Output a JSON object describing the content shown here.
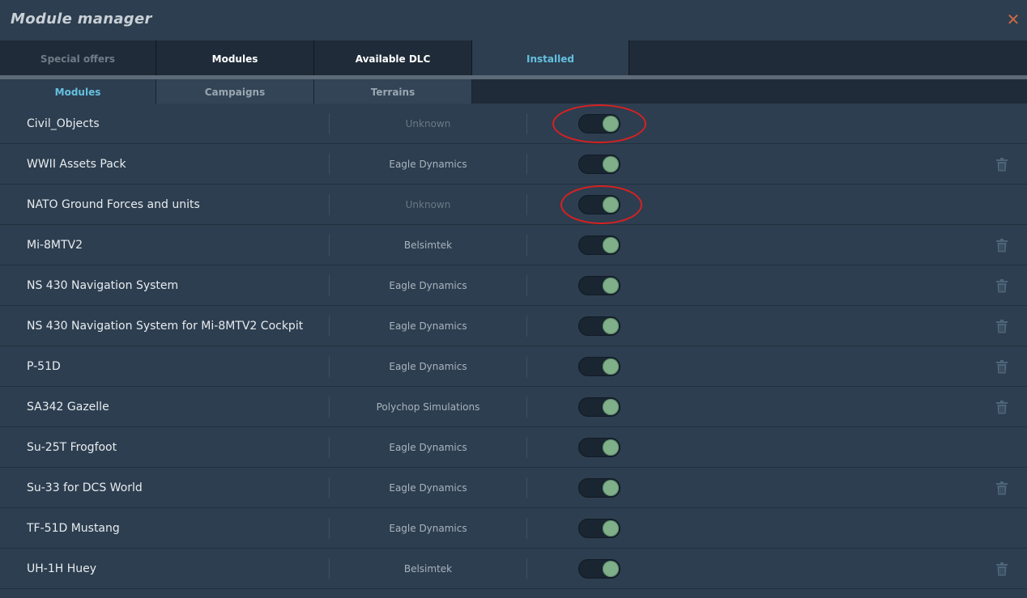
{
  "window": {
    "title": "Module manager",
    "close_icon": "close-icon",
    "close_glyph": "✕"
  },
  "main_tabs": [
    {
      "label": "Special offers",
      "state": "dim"
    },
    {
      "label": "Modules",
      "state": "normal"
    },
    {
      "label": "Available DLC",
      "state": "normal"
    },
    {
      "label": "Installed",
      "state": "active"
    }
  ],
  "sub_tabs": [
    {
      "label": "Modules",
      "state": "active"
    },
    {
      "label": "Campaigns",
      "state": "normal"
    },
    {
      "label": "Terrains",
      "state": "normal"
    }
  ],
  "modules": [
    {
      "name": "Civil_Objects",
      "developer": "Unknown",
      "enabled": true,
      "deletable": false,
      "highlighted": true
    },
    {
      "name": "WWII Assets Pack",
      "developer": "Eagle Dynamics",
      "enabled": true,
      "deletable": true,
      "highlighted": false
    },
    {
      "name": "NATO Ground Forces and units",
      "developer": "Unknown",
      "enabled": true,
      "deletable": false,
      "highlighted": true
    },
    {
      "name": "Mi-8MTV2",
      "developer": "Belsimtek",
      "enabled": true,
      "deletable": true,
      "highlighted": false
    },
    {
      "name": "NS 430 Navigation System",
      "developer": "Eagle Dynamics",
      "enabled": true,
      "deletable": true,
      "highlighted": false
    },
    {
      "name": "NS 430 Navigation System for Mi-8MTV2 Cockpit",
      "developer": "Eagle Dynamics",
      "enabled": true,
      "deletable": true,
      "highlighted": false
    },
    {
      "name": "P-51D",
      "developer": "Eagle Dynamics",
      "enabled": true,
      "deletable": true,
      "highlighted": false
    },
    {
      "name": "SA342 Gazelle",
      "developer": "Polychop Simulations",
      "enabled": true,
      "deletable": true,
      "highlighted": false
    },
    {
      "name": "Su-25T Frogfoot",
      "developer": "Eagle Dynamics",
      "enabled": true,
      "deletable": false,
      "highlighted": false
    },
    {
      "name": "Su-33 for DCS World",
      "developer": "Eagle Dynamics",
      "enabled": true,
      "deletable": true,
      "highlighted": false
    },
    {
      "name": "TF-51D Mustang",
      "developer": "Eagle Dynamics",
      "enabled": true,
      "deletable": false,
      "highlighted": false
    },
    {
      "name": "UH-1H Huey",
      "developer": "Belsimtek",
      "enabled": true,
      "deletable": true,
      "highlighted": false
    }
  ],
  "colors": {
    "background": "#2d3e50",
    "tab_bar": "#1f2b38",
    "accent": "#66c0e0",
    "toggle_on": "#7fb08a",
    "annotation": "#d92020",
    "close": "#c96a45"
  },
  "icons": {
    "toggle": "toggle-switch",
    "delete": "trash-icon"
  }
}
